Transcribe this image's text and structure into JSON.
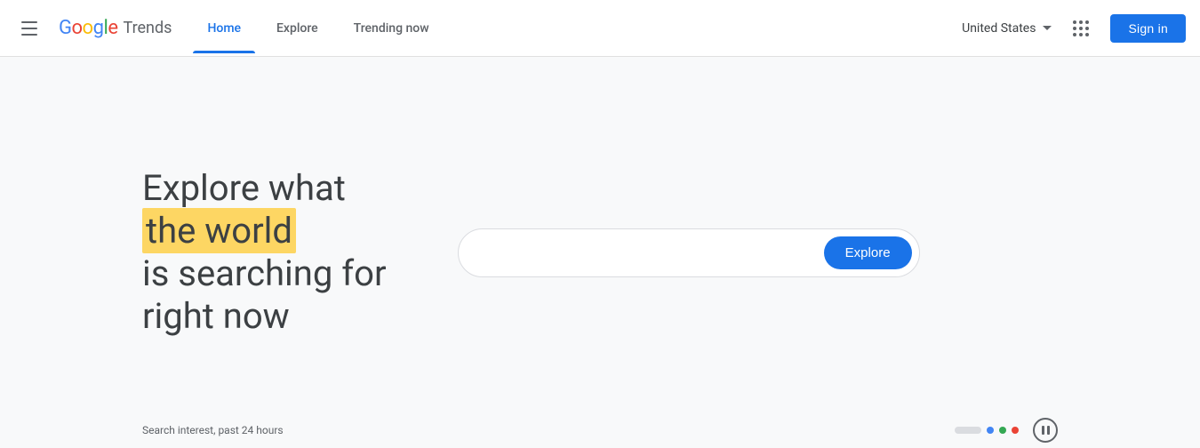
{
  "header": {
    "menu_icon_label": "menu",
    "logo": {
      "google": "Google",
      "trends": "Trends"
    },
    "nav": {
      "home": "Home",
      "explore": "Explore",
      "trending_now": "Trending now",
      "active_tab": "home"
    },
    "country": "United States",
    "sign_in": "Sign in"
  },
  "hero": {
    "line1": "Explore what",
    "line2_highlighted": "the world",
    "line3": "is searching for",
    "line4": "right now"
  },
  "search": {
    "placeholder": "",
    "explore_button": "Explore"
  },
  "bottom": {
    "search_interest_label": "Search interest, past 24 hours"
  },
  "carousel": {
    "dots": [
      {
        "type": "bar",
        "color": "#dadce0"
      },
      {
        "type": "dot",
        "color": "#4285f4"
      },
      {
        "type": "dot",
        "color": "#34a853"
      },
      {
        "type": "dot",
        "color": "#ea4335"
      }
    ]
  }
}
